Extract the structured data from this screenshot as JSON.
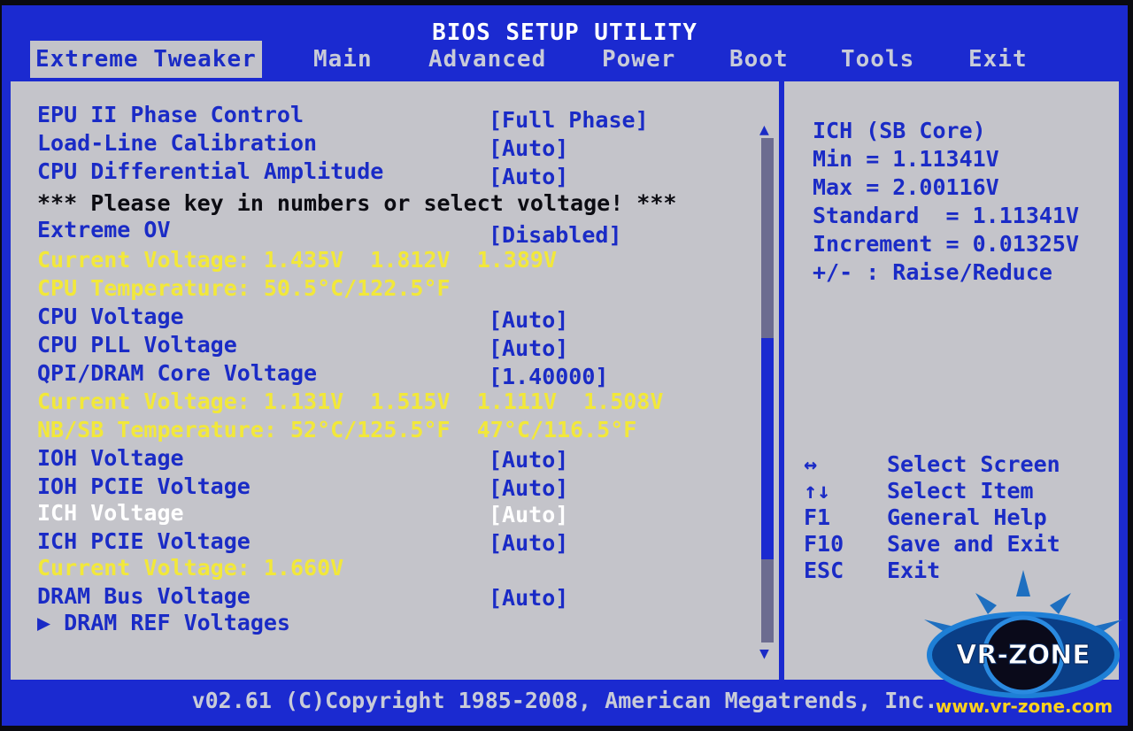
{
  "window": {
    "title": "BIOS SETUP UTILITY"
  },
  "tabs": [
    {
      "label": "Extreme Tweaker",
      "active": true
    },
    {
      "label": "Main"
    },
    {
      "label": "Advanced"
    },
    {
      "label": "Power"
    },
    {
      "label": "Boot"
    },
    {
      "label": "Tools"
    },
    {
      "label": "Exit"
    }
  ],
  "settings": {
    "epu_phase": {
      "label": "EPU II Phase Control",
      "value": "[Full Phase]"
    },
    "load_line": {
      "label": "Load-Line Calibration",
      "value": "[Auto]"
    },
    "cpu_diff_amp": {
      "label": "CPU Differential Amplitude",
      "value": "[Auto]"
    },
    "note": "*** Please key in numbers or select voltage! ***",
    "extreme_ov": {
      "label": "Extreme OV",
      "value": "[Disabled]"
    },
    "current_voltage_1": "Current Voltage: 1.435V  1.812V  1.389V",
    "cpu_temp": "CPU Temperature: 50.5°C/122.5°F",
    "cpu_voltage": {
      "label": "CPU Voltage",
      "value": "[Auto]"
    },
    "cpu_pll": {
      "label": "CPU PLL Voltage",
      "value": "[Auto]"
    },
    "qpi_dram": {
      "label": "QPI/DRAM Core Voltage",
      "value": "[1.40000]"
    },
    "current_voltage_2": "Current Voltage: 1.131V  1.515V  1.111V  1.508V",
    "nbsb_temp": "NB/SB Temperature: 52°C/125.5°F  47°C/116.5°F",
    "ioh_voltage": {
      "label": "IOH Voltage",
      "value": "[Auto]"
    },
    "ioh_pcie": {
      "label": "IOH PCIE Voltage",
      "value": "[Auto]"
    },
    "ich_voltage": {
      "label": "ICH Voltage",
      "value": "[Auto]"
    },
    "ich_pcie": {
      "label": "ICH PCIE Voltage",
      "value": "[Auto]"
    },
    "current_voltage_3": "Current Voltage: 1.660V",
    "dram_bus": {
      "label": "DRAM Bus Voltage",
      "value": "[Auto]"
    },
    "dram_ref": "▶ DRAM REF Voltages"
  },
  "help": {
    "line1": "ICH (SB Core)",
    "line2": "Min = 1.11341V",
    "line3": "Max = 2.00116V",
    "line4": "Standard  = 1.11341V",
    "line5": "Increment = 0.01325V",
    "line6": "+/- : Raise/Reduce"
  },
  "keys": [
    {
      "key": "↔",
      "desc": "Select Screen"
    },
    {
      "key": "↑↓",
      "desc": "Select Item"
    },
    {
      "key": "F1",
      "desc": "General Help"
    },
    {
      "key": "F10",
      "desc": "Save and Exit"
    },
    {
      "key": "ESC",
      "desc": "Exit"
    }
  ],
  "footer": "v02.61 (C)Copyright 1985-2008, American Megatrends, Inc.",
  "watermark": {
    "brand": "VR-ZONE",
    "url": "www.vr-zone.com"
  },
  "colors": {
    "bios_blue": "#1b2ad0",
    "panel_gray": "#c4c4ca",
    "info_yellow": "#f2e83a",
    "selected_white": "#ffffff"
  }
}
